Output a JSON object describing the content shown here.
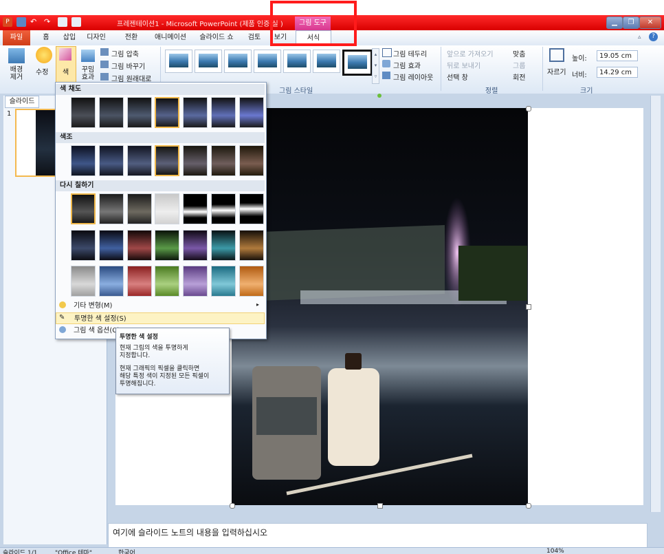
{
  "title_bar": {
    "title": "프레젠테이션1 - Microsoft PowerPoint (제품 인증 실 )",
    "context_tool": "그림 도구",
    "window_controls": [
      "minimize-icon",
      "restore-icon",
      "close-icon"
    ]
  },
  "tabs": [
    "파일",
    "홈",
    "삽입",
    "디자인",
    "전환",
    "애니메이션",
    "슬라이드 쇼",
    "검토",
    "보기",
    "서식"
  ],
  "ribbon": {
    "adjust": {
      "remove_bg": "배경 제거",
      "corrections": "수정",
      "color": "색",
      "artistic": "꾸밈 효과",
      "compress": "그림 압축",
      "change": "그림 바꾸기",
      "reset": "그림 원래대로"
    },
    "styles_group_label": "그림 스타일",
    "picture_format": {
      "border": "그림 테두리",
      "effects": "그림 효과",
      "layout": "그림 레이아웃"
    },
    "arrange": {
      "label": "정렬",
      "bring_forward": "앞으로 가져오기",
      "send_backward": "뒤로 보내기",
      "selection_pane": "선택 창",
      "align": "맞춤",
      "group": "그룹",
      "rotate": "회전"
    },
    "size": {
      "label": "크기",
      "crop": "자르기",
      "height_label": "높이:",
      "height_value": "19.05 cm",
      "width_label": "너비:",
      "width_value": "14.29 cm"
    }
  },
  "color_menu": {
    "saturation": "색 채도",
    "tone": "색조",
    "recolor": "다시 칠하기",
    "more_variations": "기타 변형(M)",
    "set_transparent": "투명한 색 설정(S)",
    "color_options": "그림 색 옵션(C)..."
  },
  "tooltip": {
    "title": "투명한 색 설정",
    "line1": "현재 그림의 색을 투명하게\n지정합니다.",
    "line2": "현재 그래픽의 픽셀을 클릭하면\n해당 특정 색이 지정된 모든 픽셀이\n투명해집니다."
  },
  "slide_pane": {
    "tab": "슬라이드",
    "slide_number": "1"
  },
  "notes_placeholder": "여기에 슬라이드 노트의 내용을 입력하십시오",
  "status": {
    "slide": "슬라이드 1/1",
    "theme": "\"Office 테마\"",
    "language": "한국어",
    "zoom": "104%"
  },
  "colors": {
    "titlebar": "#e00000",
    "file_tab": "#d9481f",
    "context_tool": "#e24c9d",
    "annotation": "#ff1b1b",
    "highlight": "#fdf3c4"
  }
}
